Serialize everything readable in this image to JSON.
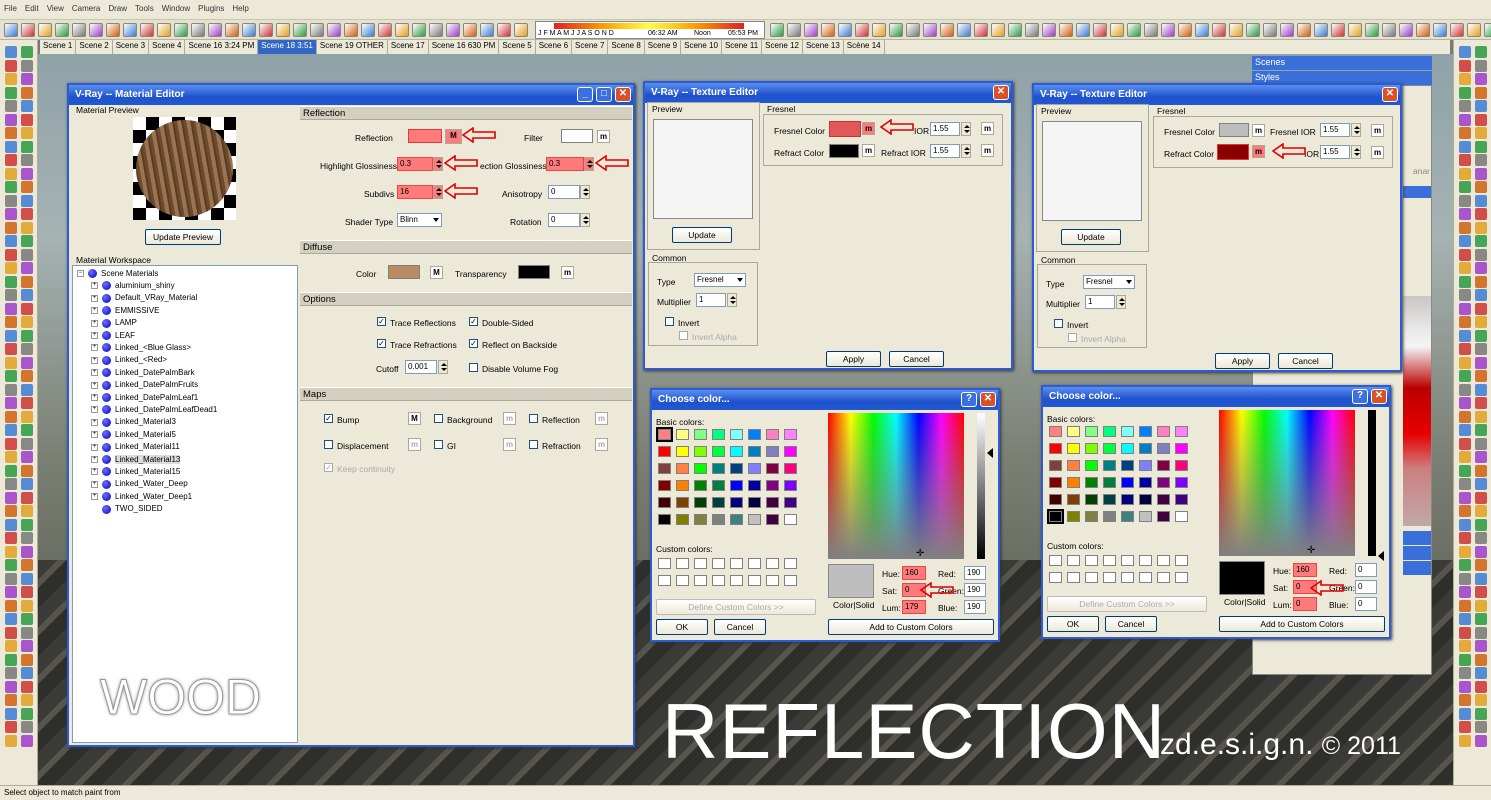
{
  "menu": [
    "File",
    "Edit",
    "View",
    "Camera",
    "Draw",
    "Tools",
    "Window",
    "Plugins",
    "Help"
  ],
  "timebar": {
    "months": "J F M A M J J A S O N D",
    "time1": "06:32 AM",
    "noon": "Noon",
    "time2": "05:53 PM"
  },
  "scenes": [
    {
      "label": "Scene 1",
      "active": false
    },
    {
      "label": "Scene 2",
      "active": false
    },
    {
      "label": "Scene 3",
      "active": false
    },
    {
      "label": "Scene 4",
      "active": false
    },
    {
      "label": "Scene 16 3:24 PM",
      "active": false
    },
    {
      "label": "Scene 18 3:51",
      "active": true
    },
    {
      "label": "Scene 19 OTHER",
      "active": false
    },
    {
      "label": "Scene 17",
      "active": false
    },
    {
      "label": "Scene 16 630 PM",
      "active": false
    },
    {
      "label": "Scene 5",
      "active": false
    },
    {
      "label": "Scene 6",
      "active": false
    },
    {
      "label": "Scene 7",
      "active": false
    },
    {
      "label": "Scene 8",
      "active": false
    },
    {
      "label": "Scene 9",
      "active": false
    },
    {
      "label": "Scene 10",
      "active": false
    },
    {
      "label": "Scene 11",
      "active": false
    },
    {
      "label": "Scene 12",
      "active": false
    },
    {
      "label": "Scene 13",
      "active": false
    },
    {
      "label": "Scène 14",
      "active": false
    }
  ],
  "status": "Select object to match paint from",
  "right_panel": {
    "scenes": "Scenes",
    "styles": "Styles",
    "fragment": "anar"
  },
  "material_editor": {
    "title": "V-Ray -- Material Editor",
    "preview_label": "Material Preview",
    "update_preview": "Update Preview",
    "workspace_label": "Material Workspace",
    "root": "Scene Materials",
    "materials": [
      "aluminium_shiny",
      "Default_VRay_Material",
      "EMMISSIVE",
      "LAMP",
      "LEAF",
      "Linked_<Blue Glass>",
      "Linked_<Red>",
      "Linked_DatePalmBark",
      "Linked_DatePalmFruits",
      "Linked_DatePalmLeaf1",
      "Linked_DatePalmLeafDead1",
      "Linked_Material3",
      "Linked_Material5",
      "Linked_Material11",
      "Linked_Material13",
      "Linked_Material15",
      "Linked_Water_Deep",
      "Linked_Water_Deep1",
      "TWO_SIDED"
    ],
    "reflection": {
      "section": "Reflection",
      "reflection": "Reflection",
      "filter": "Filter",
      "highlight_glossiness": "Highlight Glossiness",
      "hg_value": "0.3",
      "reflection_glossiness": "ection Glossiness",
      "rg_value": "0.3",
      "subdivs": "Subdivs",
      "subdivs_value": "16",
      "anisotropy": "Anisotropy",
      "anisotropy_value": "0",
      "shader_type": "Shader Type",
      "shader_value": "Blinn",
      "rotation": "Rotation",
      "rotation_value": "0",
      "m": "M",
      "m_small": "m"
    },
    "diffuse": {
      "section": "Diffuse",
      "color": "Color",
      "transparency": "Transparency",
      "m": "M",
      "m_small": "m",
      "color_hex": "#b88b62"
    },
    "options": {
      "section": "Options",
      "trace_reflections": "Trace Reflections",
      "double_sided": "Double-Sided",
      "trace_refractions": "Trace Refractions",
      "reflect_backside": "Reflect on Backside",
      "cutoff": "Cutoff",
      "cutoff_value": "0.001",
      "disable_volume_fog": "Disable Volume Fog"
    },
    "maps": {
      "section": "Maps",
      "bump": "Bump",
      "background": "Background",
      "reflection": "Reflection",
      "displacement": "Displacement",
      "gi": "GI",
      "refraction": "Refraction",
      "keep_continuity": "Keep continuity",
      "m_big": "M",
      "m_small": "m"
    }
  },
  "texture_editor_1": {
    "title": "V-Ray -- Texture Editor",
    "preview": "Preview",
    "update": "Update",
    "fresnel": "Fresnel",
    "fresnel_color": "Fresnel Color",
    "ior_label": "IOR",
    "ior_value": "1.55",
    "refract_color": "Refract Color",
    "refract_ior": "Refract IOR",
    "refract_ior_value": "1.55",
    "common": "Common",
    "type": "Type",
    "type_value": "Fresnel",
    "multiplier": "Multiplier",
    "multiplier_value": "1",
    "invert": "Invert",
    "invert_alpha": "Invert Alpha",
    "apply": "Apply",
    "cancel": "Cancel",
    "m": "m"
  },
  "texture_editor_2": {
    "title": "V-Ray -- Texture Editor",
    "preview": "Preview",
    "update": "Update",
    "fresnel": "Fresnel",
    "fresnel_color": "Fresnel Color",
    "fresnel_ior": "Fresnel IOR",
    "ior_value": "1.55",
    "refract_color": "Refract Color",
    "ior_label": "IOR",
    "refract_ior_value": "1.55",
    "common": "Common",
    "type": "Type",
    "type_value": "Fresnel",
    "multiplier": "Multiplier",
    "multiplier_value": "1",
    "invert": "Invert",
    "invert_alpha": "Invert Alpha",
    "apply": "Apply",
    "cancel": "Cancel",
    "m": "m"
  },
  "color_dialog_1": {
    "title": "Choose color...",
    "basic": "Basic colors:",
    "custom": "Custom colors:",
    "define": "Define Custom Colors >>",
    "ok": "OK",
    "cancel": "Cancel",
    "hue": "Hue:",
    "hue_value": "160",
    "sat": "Sat:",
    "sat_value": "0",
    "lum": "Lum:",
    "lum_value": "179",
    "red": "Red:",
    "red_value": "190",
    "green": "Green:",
    "green_value": "190",
    "blue": "Blue:",
    "blue_value": "190",
    "colorsolid": "Color|Solid",
    "add_custom": "Add to Custom Colors",
    "swatch": "#bebebe",
    "q": "?"
  },
  "color_dialog_2": {
    "title": "Choose color...",
    "basic": "Basic colors:",
    "custom": "Custom colors:",
    "define": "Define Custom Colors >>",
    "ok": "OK",
    "cancel": "Cancel",
    "hue": "Hue:",
    "hue_value": "160",
    "sat": "Sat:",
    "sat_value": "0",
    "lum": "Lum:",
    "lum_value": "0",
    "red": "Red:",
    "red_value": "0",
    "green": "Green:",
    "green_value": "0",
    "blue": "Blue:",
    "blue_value": "0",
    "colorsolid": "Color|Solid",
    "add_custom": "Add to Custom Colors",
    "swatch": "#000000",
    "q": "?"
  },
  "basic_colors": [
    "#ff8080",
    "#ffff80",
    "#80ff80",
    "#00ff80",
    "#80ffff",
    "#0080ff",
    "#ff80c0",
    "#ff80ff",
    "#ff0000",
    "#ffff00",
    "#80ff00",
    "#00ff40",
    "#00ffff",
    "#0080c0",
    "#8080c0",
    "#ff00ff",
    "#804040",
    "#ff8040",
    "#00ff00",
    "#008080",
    "#004080",
    "#8080ff",
    "#800040",
    "#ff0080",
    "#800000",
    "#ff8000",
    "#008000",
    "#008040",
    "#0000ff",
    "#0000a0",
    "#800080",
    "#8000ff",
    "#400000",
    "#804000",
    "#004000",
    "#004040",
    "#000080",
    "#000040",
    "#400040",
    "#400080",
    "#000000",
    "#808000",
    "#808040",
    "#808080",
    "#408080",
    "#c0c0c0",
    "#400040",
    "#ffffff"
  ],
  "watermark": {
    "wood": "WOOD",
    "reflection": "REFLECTION",
    "brand": "zd.e.s.i.g.n.",
    "year": "© 2011"
  },
  "colors": {
    "highlight": "#ff7b7b",
    "arrow": "#e00000",
    "title_blue": "#2159d3"
  }
}
